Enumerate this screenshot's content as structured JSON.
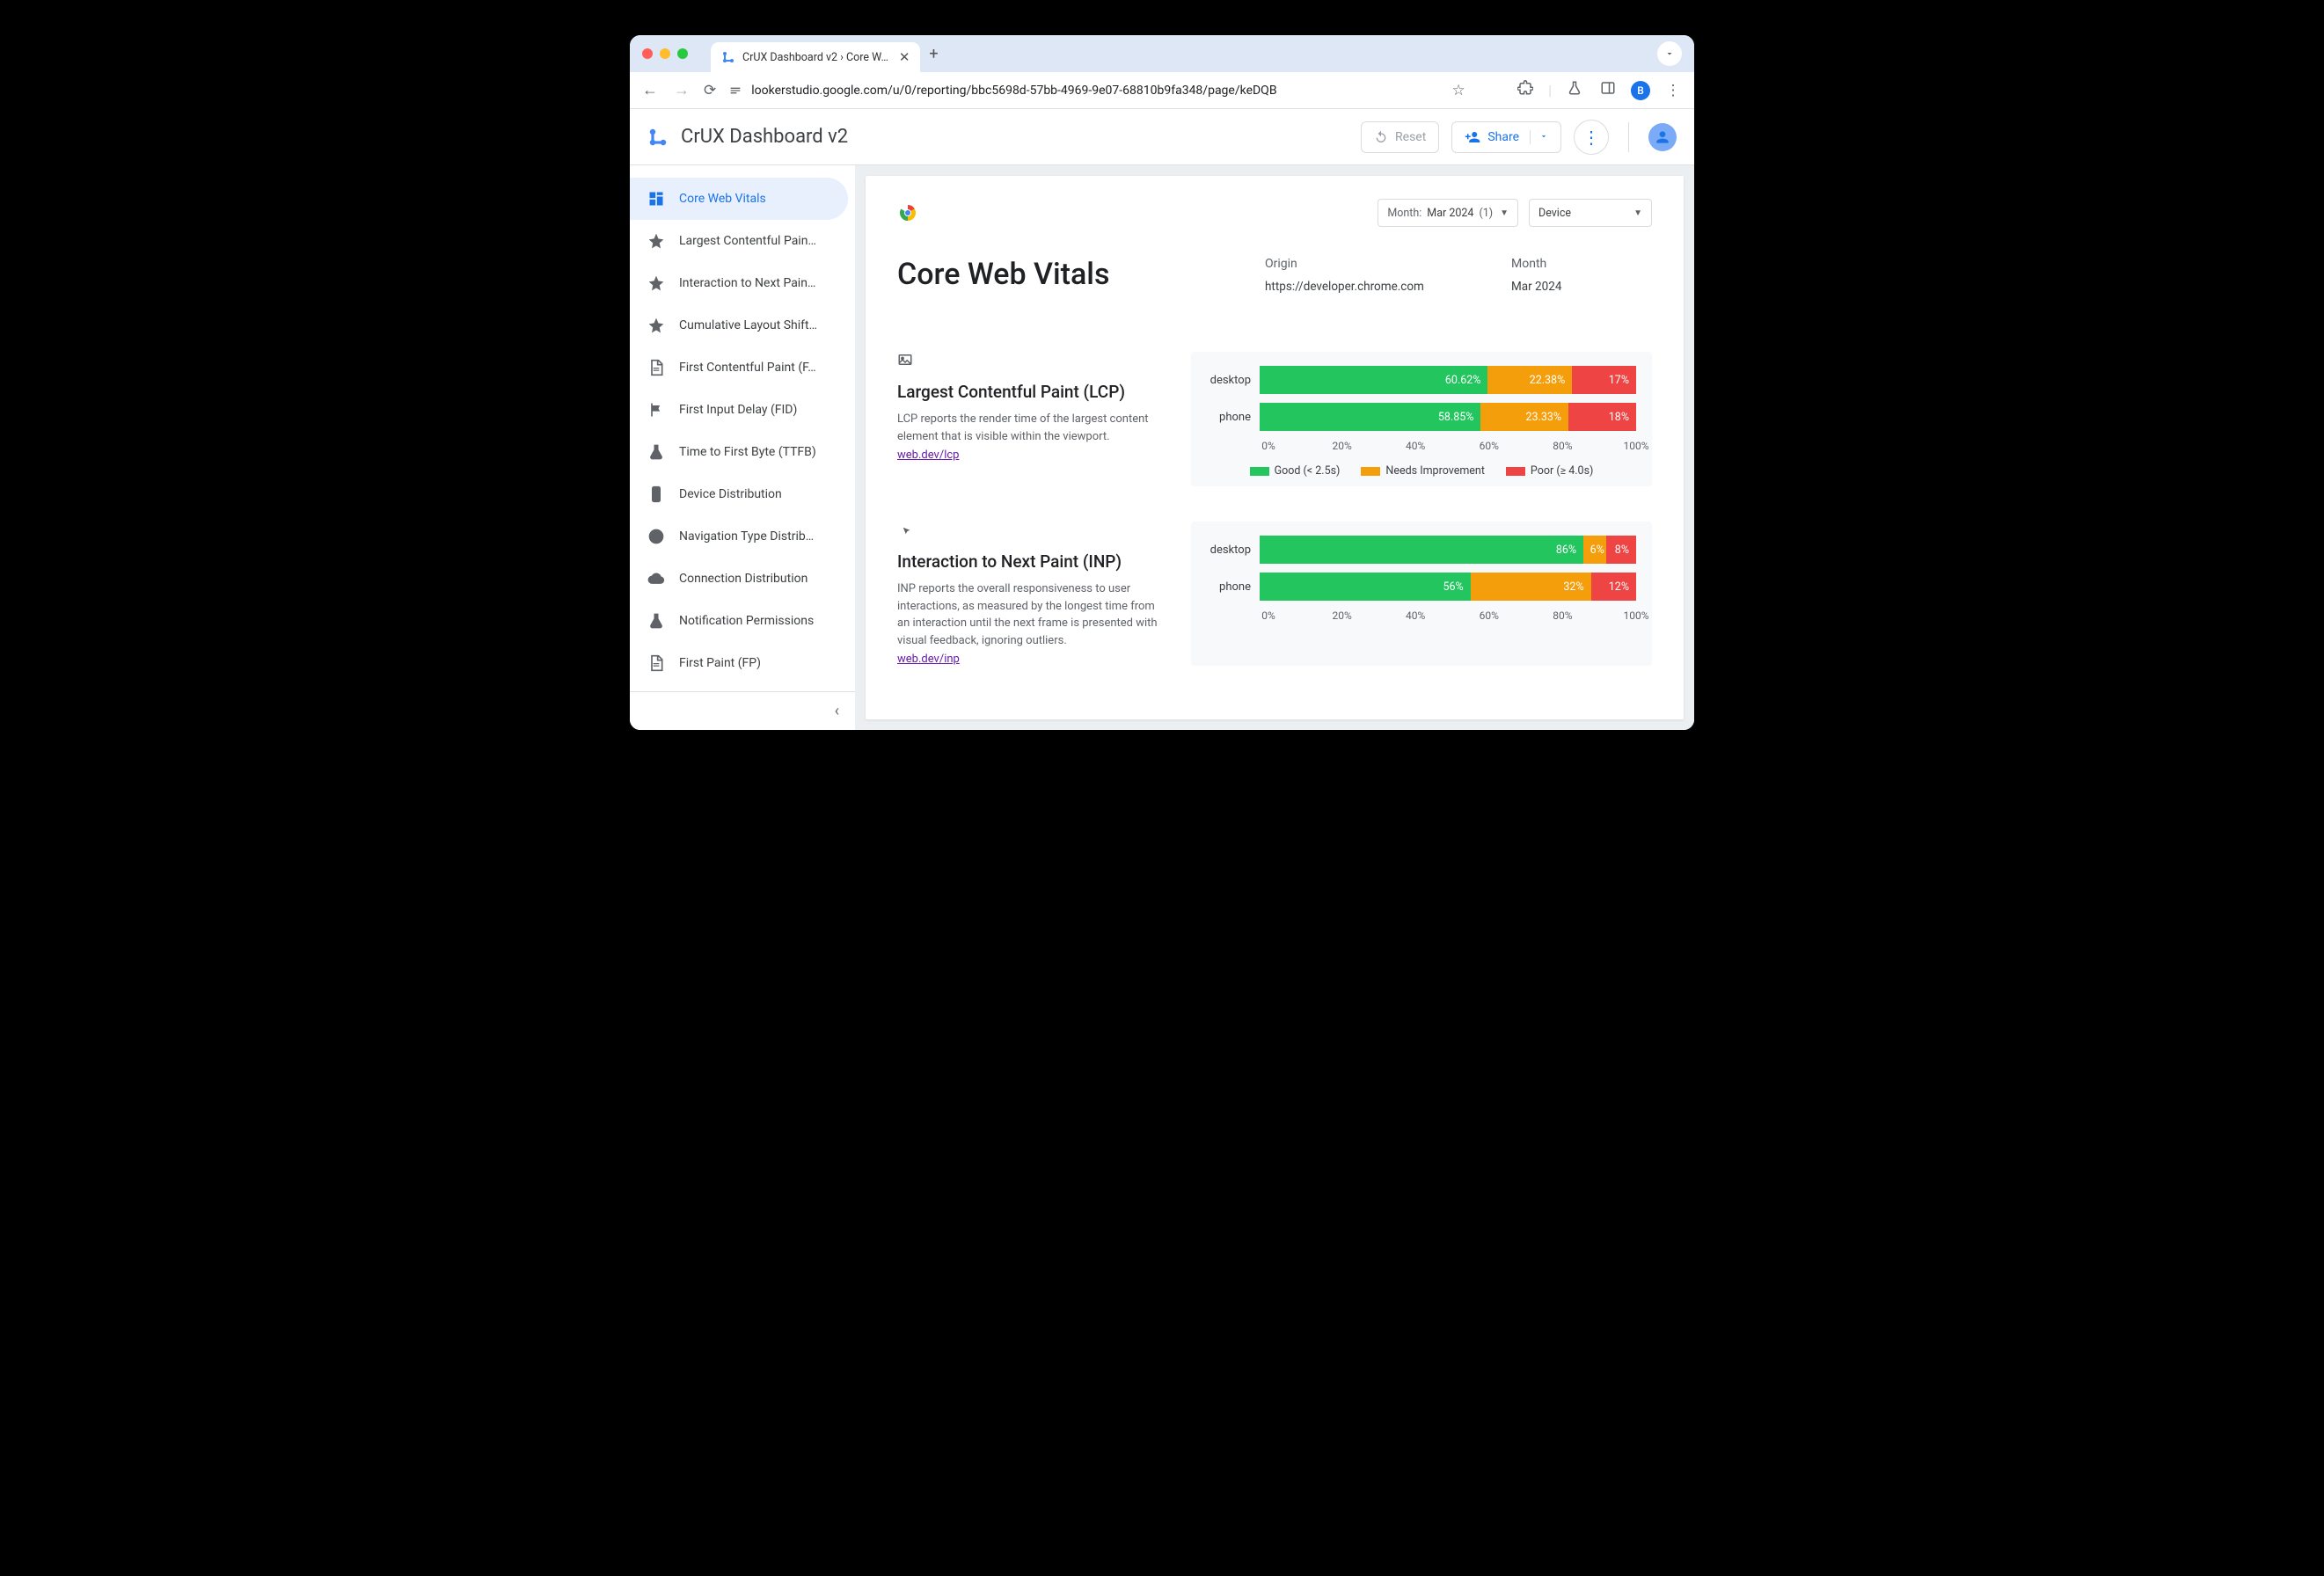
{
  "browser": {
    "tab_title": "CrUX Dashboard v2 › Core W…",
    "url": "lookerstudio.google.com/u/0/reporting/bbc5698d-57bb-4969-9e07-68810b9fa348/page/keDQB",
    "avatar_letter": "B"
  },
  "header": {
    "app_title": "CrUX Dashboard v2",
    "reset": "Reset",
    "share": "Share"
  },
  "sidebar": {
    "items": [
      {
        "label": "Core Web Vitals",
        "icon": "dashboard"
      },
      {
        "label": "Largest Contentful Pain…",
        "icon": "star"
      },
      {
        "label": "Interaction to Next Pain…",
        "icon": "star"
      },
      {
        "label": "Cumulative Layout Shift…",
        "icon": "star"
      },
      {
        "label": "First Contentful Paint (F…",
        "icon": "doc"
      },
      {
        "label": "First Input Delay (FID)",
        "icon": "flag"
      },
      {
        "label": "Time to First Byte (TTFB)",
        "icon": "flask"
      },
      {
        "label": "Device Distribution",
        "icon": "phone"
      },
      {
        "label": "Navigation Type Distrib…",
        "icon": "compass"
      },
      {
        "label": "Connection Distribution",
        "icon": "cloud"
      },
      {
        "label": "Notification Permissions",
        "icon": "flask"
      },
      {
        "label": "First Paint (FP)",
        "icon": "doc"
      }
    ]
  },
  "filters": {
    "month_label": "Month:",
    "month_value": "Mar 2024",
    "month_count": "(1)",
    "device_label": "Device"
  },
  "page": {
    "title": "Core Web Vitals",
    "origin_label": "Origin",
    "origin_value": "https://developer.chrome.com",
    "month_label": "Month",
    "month_value": "Mar 2024"
  },
  "metrics": [
    {
      "title": "Largest Contentful Paint (LCP)",
      "desc": "LCP reports the render time of the largest content element that is visible within the viewport.",
      "link": "web.dev/lcp",
      "legend": {
        "good": "Good (< 2.5s)",
        "ni": "Needs Improvement",
        "poor": "Poor (≥ 4.0s)"
      }
    },
    {
      "title": "Interaction to Next Paint (INP)",
      "desc": "INP reports the overall responsiveness to user interactions, as measured by the longest time from an interaction until the next frame is presented with visual feedback, ignoring outliers.",
      "link": "web.dev/inp"
    }
  ],
  "axis": {
    "t0": "0%",
    "t20": "20%",
    "t40": "40%",
    "t60": "60%",
    "t80": "80%",
    "t100": "100%"
  },
  "chart_data": [
    {
      "type": "bar",
      "title": "Largest Contentful Paint (LCP)",
      "categories": [
        "desktop",
        "phone"
      ],
      "series": [
        {
          "name": "Good (< 2.5s)",
          "color": "#22c55e",
          "values": [
            60.62,
            58.85
          ]
        },
        {
          "name": "Needs Improvement",
          "color": "#f59e0b",
          "values": [
            22.38,
            23.33
          ]
        },
        {
          "name": "Poor (≥ 4.0s)",
          "color": "#ef4444",
          "values": [
            17,
            18
          ]
        }
      ],
      "labels": {
        "desktop": {
          "good": "60.62%",
          "ni": "22.38%",
          "poor": "17%"
        },
        "phone": {
          "good": "58.85%",
          "ni": "23.33%",
          "poor": "18%"
        }
      },
      "xlabel": "",
      "ylabel": "",
      "xlim": [
        0,
        100
      ]
    },
    {
      "type": "bar",
      "title": "Interaction to Next Paint (INP)",
      "categories": [
        "desktop",
        "phone"
      ],
      "series": [
        {
          "name": "Good",
          "color": "#22c55e",
          "values": [
            86,
            56
          ]
        },
        {
          "name": "Needs Improvement",
          "color": "#f59e0b",
          "values": [
            6,
            32
          ]
        },
        {
          "name": "Poor",
          "color": "#ef4444",
          "values": [
            8,
            12
          ]
        }
      ],
      "labels": {
        "desktop": {
          "good": "86%",
          "ni": "6%",
          "poor": "8%"
        },
        "phone": {
          "good": "56%",
          "ni": "32%",
          "poor": "12%"
        }
      },
      "xlabel": "",
      "ylabel": "",
      "xlim": [
        0,
        100
      ]
    }
  ]
}
